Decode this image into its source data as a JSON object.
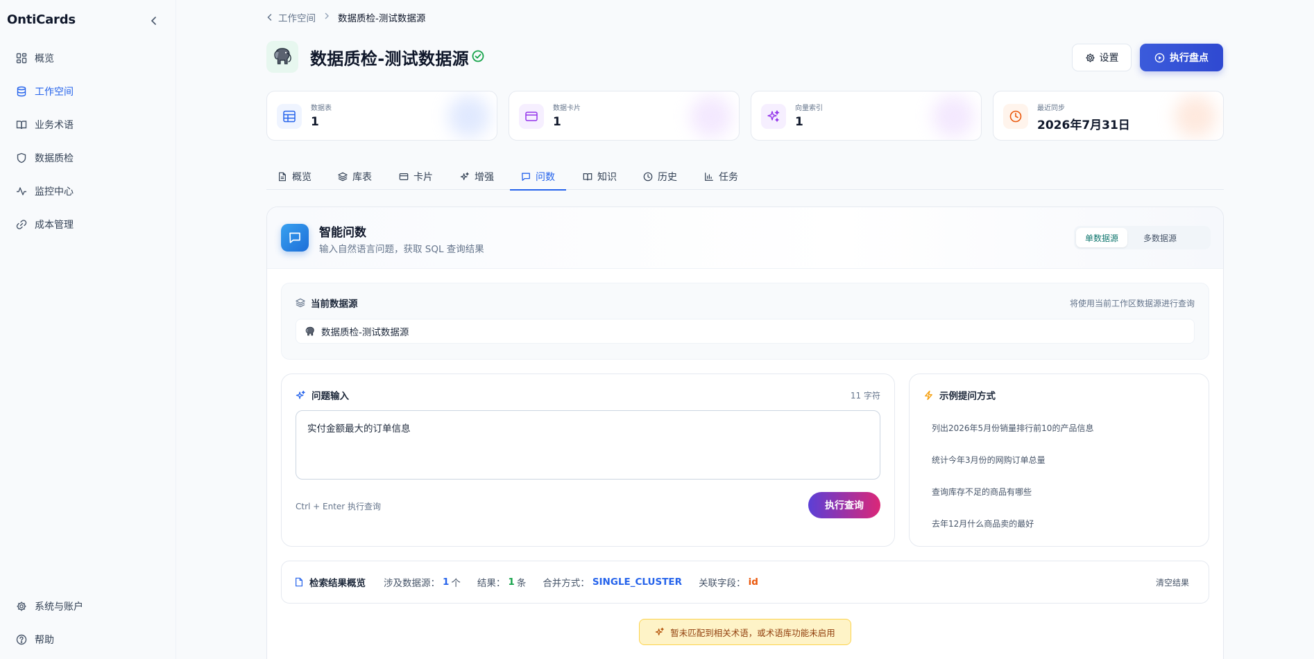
{
  "app": {
    "name": "OntiCards"
  },
  "sidebar": {
    "items": [
      {
        "label": "概览",
        "icon": "dashboard-icon",
        "active": false
      },
      {
        "label": "工作空间",
        "icon": "database-icon",
        "active": true
      },
      {
        "label": "业务术语",
        "icon": "book-icon",
        "active": false
      },
      {
        "label": "数据质检",
        "icon": "shield-icon",
        "active": false
      },
      {
        "label": "监控中心",
        "icon": "activity-icon",
        "active": false
      },
      {
        "label": "成本管理",
        "icon": "link-icon",
        "active": false
      }
    ],
    "bottom": [
      {
        "label": "系统与账户",
        "icon": "gear-icon"
      },
      {
        "label": "帮助",
        "icon": "help-icon"
      }
    ]
  },
  "breadcrumb": {
    "parent": "工作空间",
    "current": "数据质检-测试数据源"
  },
  "header": {
    "title": "数据质检-测试数据源",
    "settings_label": "设置",
    "run_label": "执行盘点"
  },
  "stats": [
    {
      "label": "数据表",
      "value": "1",
      "icon": "table-icon",
      "color": "#2563eb"
    },
    {
      "label": "数据卡片",
      "value": "1",
      "icon": "card-icon",
      "color": "#9333ea"
    },
    {
      "label": "向量索引",
      "value": "1",
      "icon": "sparkles-icon",
      "color": "#9333ea"
    },
    {
      "label": "最近同步",
      "value": "2026年7月31日",
      "icon": "clock-icon",
      "color": "#ea580c"
    }
  ],
  "tabs": [
    {
      "label": "概览",
      "icon": "file-icon"
    },
    {
      "label": "库表",
      "icon": "layers-icon"
    },
    {
      "label": "卡片",
      "icon": "card-icon"
    },
    {
      "label": "增强",
      "icon": "sparkles-icon"
    },
    {
      "label": "问数",
      "icon": "chat-icon",
      "active": true
    },
    {
      "label": "知识",
      "icon": "book-icon"
    },
    {
      "label": "历史",
      "icon": "clock-icon"
    },
    {
      "label": "任务",
      "icon": "bar-chart-icon"
    }
  ],
  "panel": {
    "title": "智能问数",
    "subtitle": "输入自然语言问题，获取 SQL 查询结果",
    "mode_single": "单数据源",
    "mode_multi": "多数据源"
  },
  "source": {
    "title": "当前数据源",
    "note": "将使用当前工作区数据源进行查询",
    "name": "数据质检-测试数据源"
  },
  "question": {
    "title": "问题输入",
    "count": "11 字符",
    "value": "实付金额最大的订单信息",
    "hint": "Ctrl + Enter 执行查询",
    "submit": "执行查询"
  },
  "examples": {
    "title": "示例提问方式",
    "items": [
      "列出2026年5月份销量排行前10的产品信息",
      "统计今年3月份的网购订单总量",
      "查询库存不足的商品有哪些",
      "去年12月什么商品卖的最好"
    ]
  },
  "result": {
    "title": "检索结果概览",
    "sources_key": "涉及数据源：",
    "sources_val": "1",
    "sources_unit": "个",
    "rows_key": "结果：",
    "rows_val": "1",
    "rows_unit": "条",
    "merge_key": "合并方式：",
    "merge_val": "SINGLE_CLUSTER",
    "field_key": "关联字段：",
    "field_val": "id",
    "clear": "清空结果"
  },
  "warning": {
    "text": "暂未匹配到相关术语，或术语库功能未启用"
  },
  "colors": {
    "accent": "#2563eb",
    "success": "#16a34a",
    "warning_bg": "#fef3c7"
  }
}
